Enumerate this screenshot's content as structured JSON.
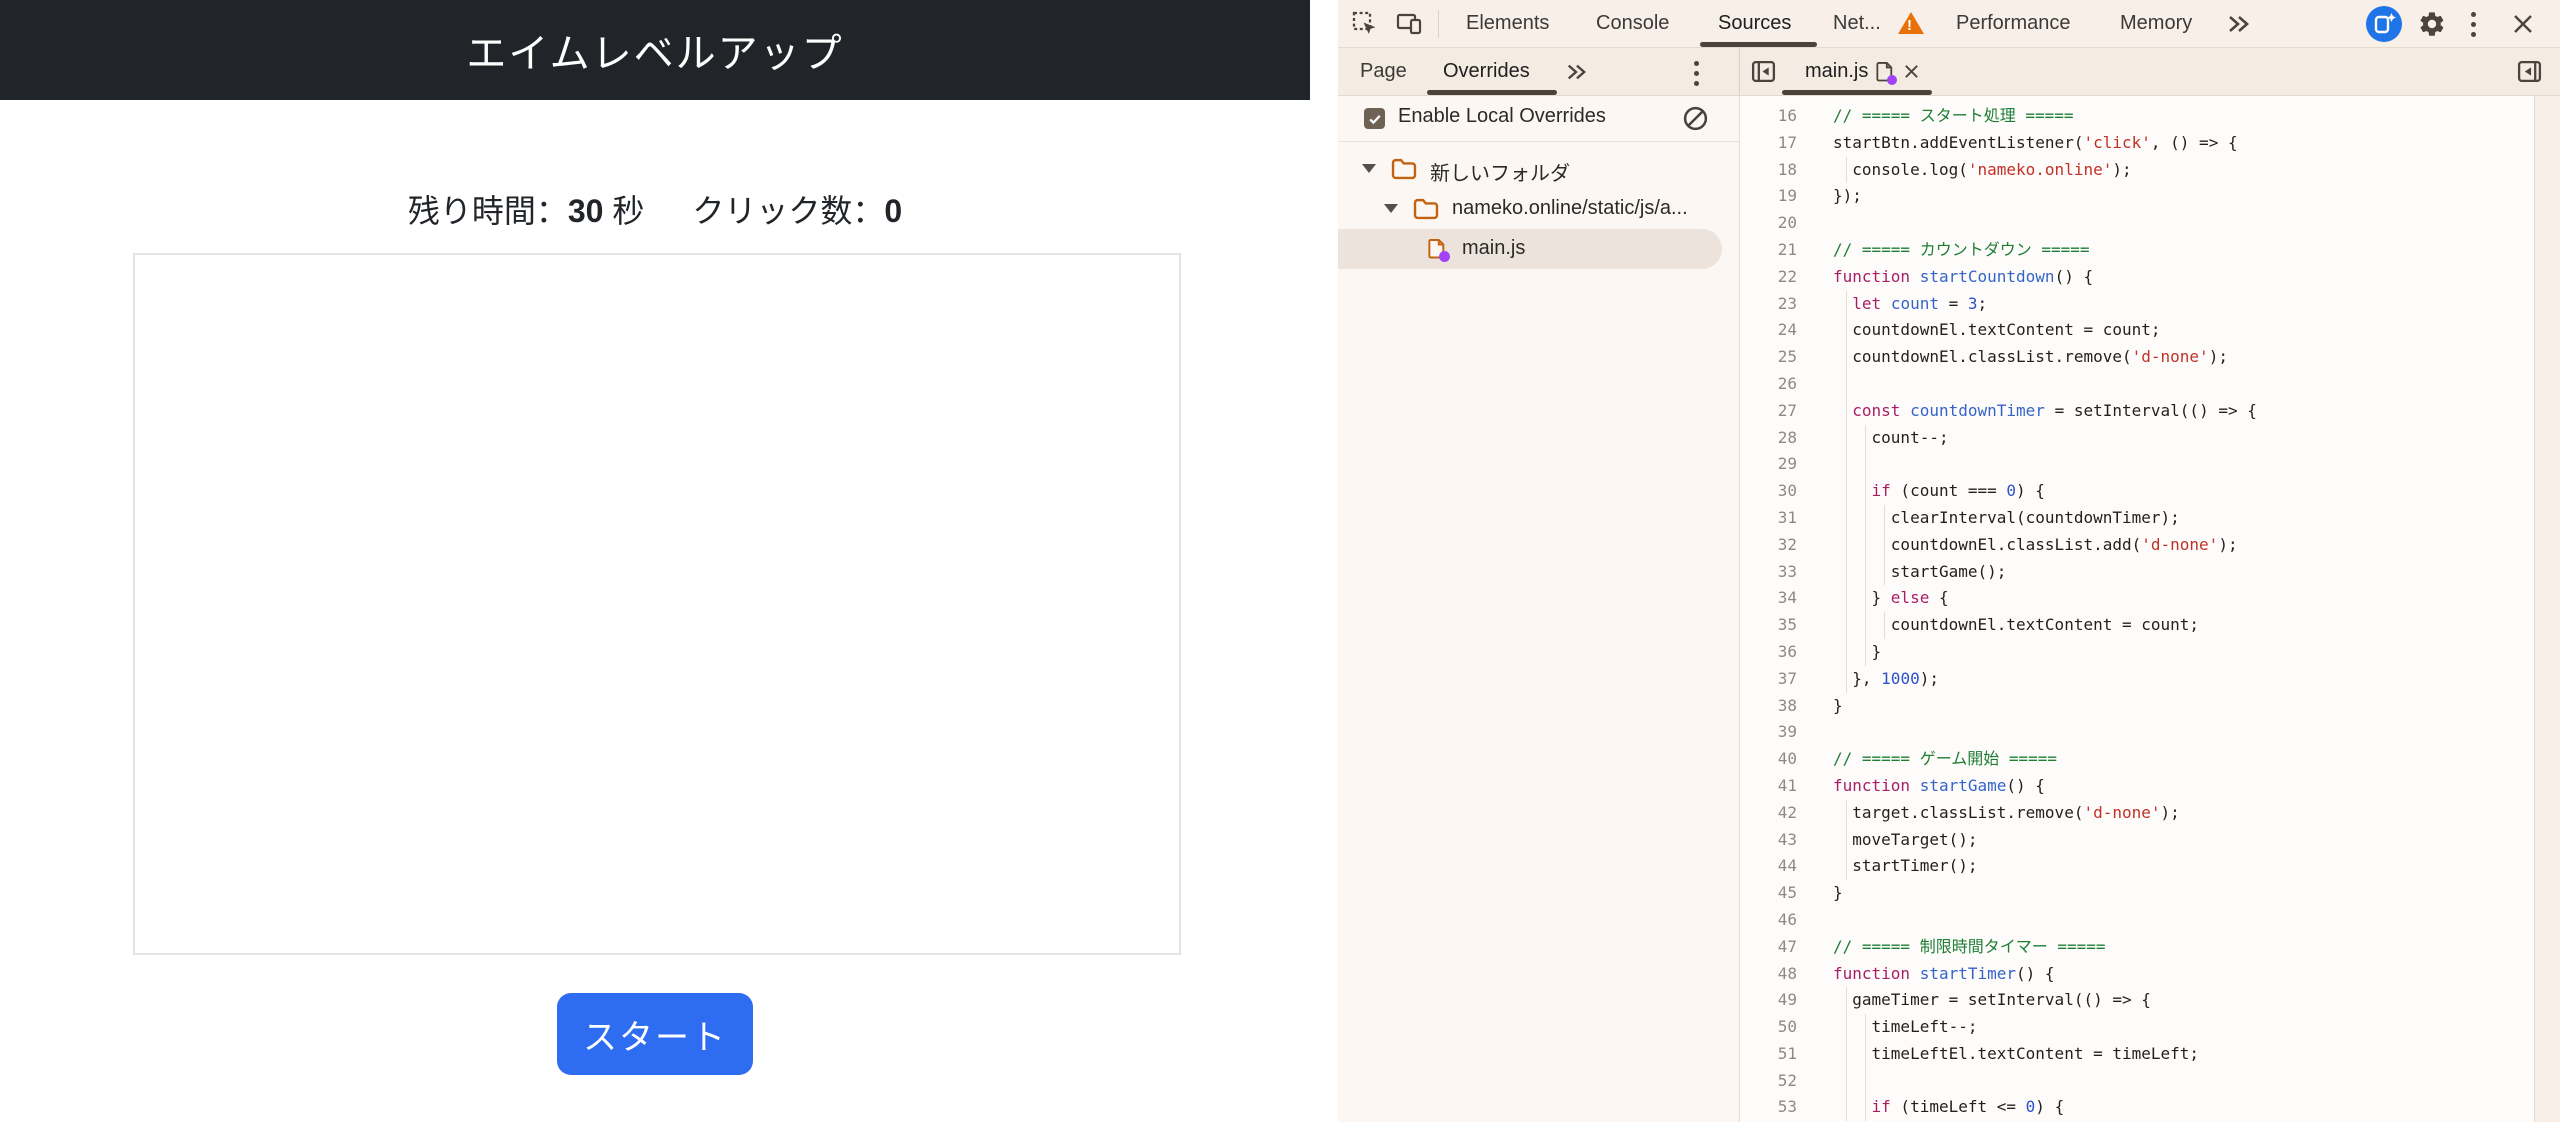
{
  "page": {
    "title": "エイムレベルアップ",
    "stats": {
      "time_label": "残り時間：",
      "time_value": "30",
      "time_unit": " 秒",
      "click_label": "クリック数：",
      "click_value": "0"
    },
    "start_button_label": "スタート"
  },
  "devtools": {
    "main_tabs": {
      "elements": "Elements",
      "console": "Console",
      "sources": "Sources",
      "network": "Net...",
      "performance": "Performance",
      "memory": "Memory",
      "selected": "Sources"
    },
    "sources_subtabs": {
      "page": "Page",
      "overrides": "Overrides",
      "selected": "Overrides"
    },
    "overrides_panel": {
      "enable_label": "Enable Local Overrides",
      "checkbox_checked": true
    },
    "file_tree": {
      "folder_root": "新しいフォルダ",
      "folder_child": "nameko.online/static/js/a...",
      "file": "main.js",
      "selected_file": "main.js"
    },
    "editor_tab_label": "main.js",
    "colors": {
      "start_button": "#2e6cf2",
      "folder_icon": "#c26312",
      "override_dot": "#a142f4",
      "warning_triangle": "#e8710a",
      "ai_button": "#1f74e8",
      "comment": "#1e7e34",
      "keyword": "#a81d67",
      "string": "#c03026",
      "number": "#2d4fcc"
    },
    "code": {
      "first_line_number": 16,
      "last_line_number": 53,
      "lines": [
        {
          "n": 16,
          "g": 0,
          "t": [
            [
              "c",
              "// ===== スタート処理 ====="
            ]
          ]
        },
        {
          "n": 17,
          "g": 0,
          "t": [
            [
              "p",
              "startBtn.addEventListener("
            ],
            [
              "s",
              "'click'"
            ],
            [
              "p",
              ", () => {"
            ]
          ]
        },
        {
          "n": 18,
          "g": 1,
          "t": [
            [
              "p",
              "  console.log("
            ],
            [
              "s",
              "'nameko.online'"
            ],
            [
              "p",
              ");"
            ]
          ]
        },
        {
          "n": 19,
          "g": 0,
          "t": [
            [
              "p",
              "});"
            ]
          ]
        },
        {
          "n": 20,
          "g": 0,
          "t": []
        },
        {
          "n": 21,
          "g": 0,
          "t": [
            [
              "c",
              "// ===== カウントダウン ====="
            ]
          ]
        },
        {
          "n": 22,
          "g": 0,
          "t": [
            [
              "k",
              "function"
            ],
            [
              "p",
              " "
            ],
            [
              "d",
              "startCountdown"
            ],
            [
              "p",
              "() {"
            ]
          ]
        },
        {
          "n": 23,
          "g": 1,
          "t": [
            [
              "p",
              "  "
            ],
            [
              "k",
              "let"
            ],
            [
              "p",
              " "
            ],
            [
              "d",
              "count"
            ],
            [
              "p",
              " = "
            ],
            [
              "n2",
              "3"
            ],
            [
              "p",
              ";"
            ]
          ]
        },
        {
          "n": 24,
          "g": 1,
          "t": [
            [
              "p",
              "  countdownEl.textContent = count;"
            ]
          ]
        },
        {
          "n": 25,
          "g": 1,
          "t": [
            [
              "p",
              "  countdownEl.classList.remove("
            ],
            [
              "s",
              "'d-none'"
            ],
            [
              "p",
              ");"
            ]
          ]
        },
        {
          "n": 26,
          "g": 1,
          "t": []
        },
        {
          "n": 27,
          "g": 1,
          "t": [
            [
              "p",
              "  "
            ],
            [
              "k",
              "const"
            ],
            [
              "p",
              " "
            ],
            [
              "d",
              "countdownTimer"
            ],
            [
              "p",
              " = setInterval(() => {"
            ]
          ]
        },
        {
          "n": 28,
          "g": 2,
          "t": [
            [
              "p",
              "    count--;"
            ]
          ]
        },
        {
          "n": 29,
          "g": 2,
          "t": []
        },
        {
          "n": 30,
          "g": 2,
          "t": [
            [
              "p",
              "    "
            ],
            [
              "k",
              "if"
            ],
            [
              "p",
              " (count === "
            ],
            [
              "n2",
              "0"
            ],
            [
              "p",
              ") {"
            ]
          ]
        },
        {
          "n": 31,
          "g": 3,
          "t": [
            [
              "p",
              "      clearInterval(countdownTimer);"
            ]
          ]
        },
        {
          "n": 32,
          "g": 3,
          "t": [
            [
              "p",
              "      countdownEl.classList.add("
            ],
            [
              "s",
              "'d-none'"
            ],
            [
              "p",
              ");"
            ]
          ]
        },
        {
          "n": 33,
          "g": 3,
          "t": [
            [
              "p",
              "      startGame();"
            ]
          ]
        },
        {
          "n": 34,
          "g": 2,
          "t": [
            [
              "p",
              "    } "
            ],
            [
              "k",
              "else"
            ],
            [
              "p",
              " {"
            ]
          ]
        },
        {
          "n": 35,
          "g": 3,
          "t": [
            [
              "p",
              "      countdownEl.textContent = count;"
            ]
          ]
        },
        {
          "n": 36,
          "g": 2,
          "t": [
            [
              "p",
              "    }"
            ]
          ]
        },
        {
          "n": 37,
          "g": 1,
          "t": [
            [
              "p",
              "  }, "
            ],
            [
              "n2",
              "1000"
            ],
            [
              "p",
              ");"
            ]
          ]
        },
        {
          "n": 38,
          "g": 0,
          "t": [
            [
              "p",
              "}"
            ]
          ]
        },
        {
          "n": 39,
          "g": 0,
          "t": []
        },
        {
          "n": 40,
          "g": 0,
          "t": [
            [
              "c",
              "// ===== ゲーム開始 ====="
            ]
          ]
        },
        {
          "n": 41,
          "g": 0,
          "t": [
            [
              "k",
              "function"
            ],
            [
              "p",
              " "
            ],
            [
              "d",
              "startGame"
            ],
            [
              "p",
              "() {"
            ]
          ]
        },
        {
          "n": 42,
          "g": 1,
          "t": [
            [
              "p",
              "  target.classList.remove("
            ],
            [
              "s",
              "'d-none'"
            ],
            [
              "p",
              ");"
            ]
          ]
        },
        {
          "n": 43,
          "g": 1,
          "t": [
            [
              "p",
              "  moveTarget();"
            ]
          ]
        },
        {
          "n": 44,
          "g": 1,
          "t": [
            [
              "p",
              "  startTimer();"
            ]
          ]
        },
        {
          "n": 45,
          "g": 0,
          "t": [
            [
              "p",
              "}"
            ]
          ]
        },
        {
          "n": 46,
          "g": 0,
          "t": []
        },
        {
          "n": 47,
          "g": 0,
          "t": [
            [
              "c",
              "// ===== 制限時間タイマー ====="
            ]
          ]
        },
        {
          "n": 48,
          "g": 0,
          "t": [
            [
              "k",
              "function"
            ],
            [
              "p",
              " "
            ],
            [
              "d",
              "startTimer"
            ],
            [
              "p",
              "() {"
            ]
          ]
        },
        {
          "n": 49,
          "g": 1,
          "t": [
            [
              "p",
              "  gameTimer = setInterval(() => {"
            ]
          ]
        },
        {
          "n": 50,
          "g": 2,
          "t": [
            [
              "p",
              "    timeLeft--;"
            ]
          ]
        },
        {
          "n": 51,
          "g": 2,
          "t": [
            [
              "p",
              "    timeLeftEl.textContent = timeLeft;"
            ]
          ]
        },
        {
          "n": 52,
          "g": 2,
          "t": []
        },
        {
          "n": 53,
          "g": 2,
          "t": [
            [
              "p",
              "    "
            ],
            [
              "k",
              "if"
            ],
            [
              "p",
              " (timeLeft <= "
            ],
            [
              "n2",
              "0"
            ],
            [
              "p",
              ") {"
            ]
          ]
        }
      ]
    }
  }
}
